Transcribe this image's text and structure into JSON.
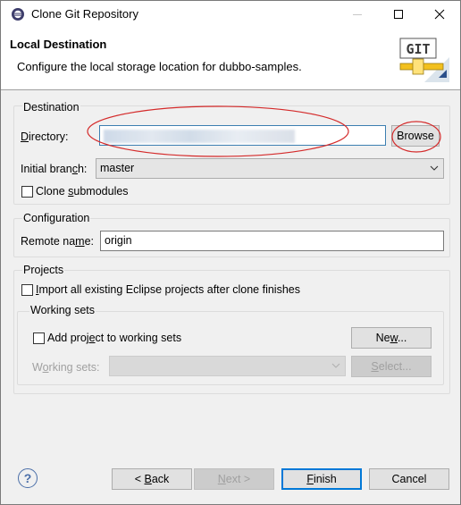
{
  "window": {
    "title": "Clone Git Repository"
  },
  "banner": {
    "title": "Local Destination",
    "description": "Configure the local storage location for dubbo-samples.",
    "logo_text": "GIT"
  },
  "destination": {
    "group_label": "Destination",
    "directory_label": "Directory:",
    "directory_value": "",
    "browse_label": "Browse",
    "branch_label": "Initial branch:",
    "branch_value": "master",
    "clone_submodules_label": "Clone submodules",
    "clone_submodules_checked": false
  },
  "configuration": {
    "group_label": "Configuration",
    "remote_name_label": "Remote name:",
    "remote_name_value": "origin"
  },
  "projects": {
    "group_label": "Projects",
    "import_label": "Import all existing Eclipse projects after clone finishes",
    "import_checked": false,
    "working_sets": {
      "group_label": "Working sets",
      "add_label": "Add project to working sets",
      "add_checked": false,
      "new_label": "New...",
      "sets_label": "Working sets:",
      "select_label": "Select..."
    }
  },
  "footer": {
    "back_label": "< Back",
    "next_label": "Next >",
    "finish_label": "Finish",
    "cancel_label": "Cancel"
  },
  "colors": {
    "accent": "#0078d7",
    "annotation": "#d42a2a"
  }
}
